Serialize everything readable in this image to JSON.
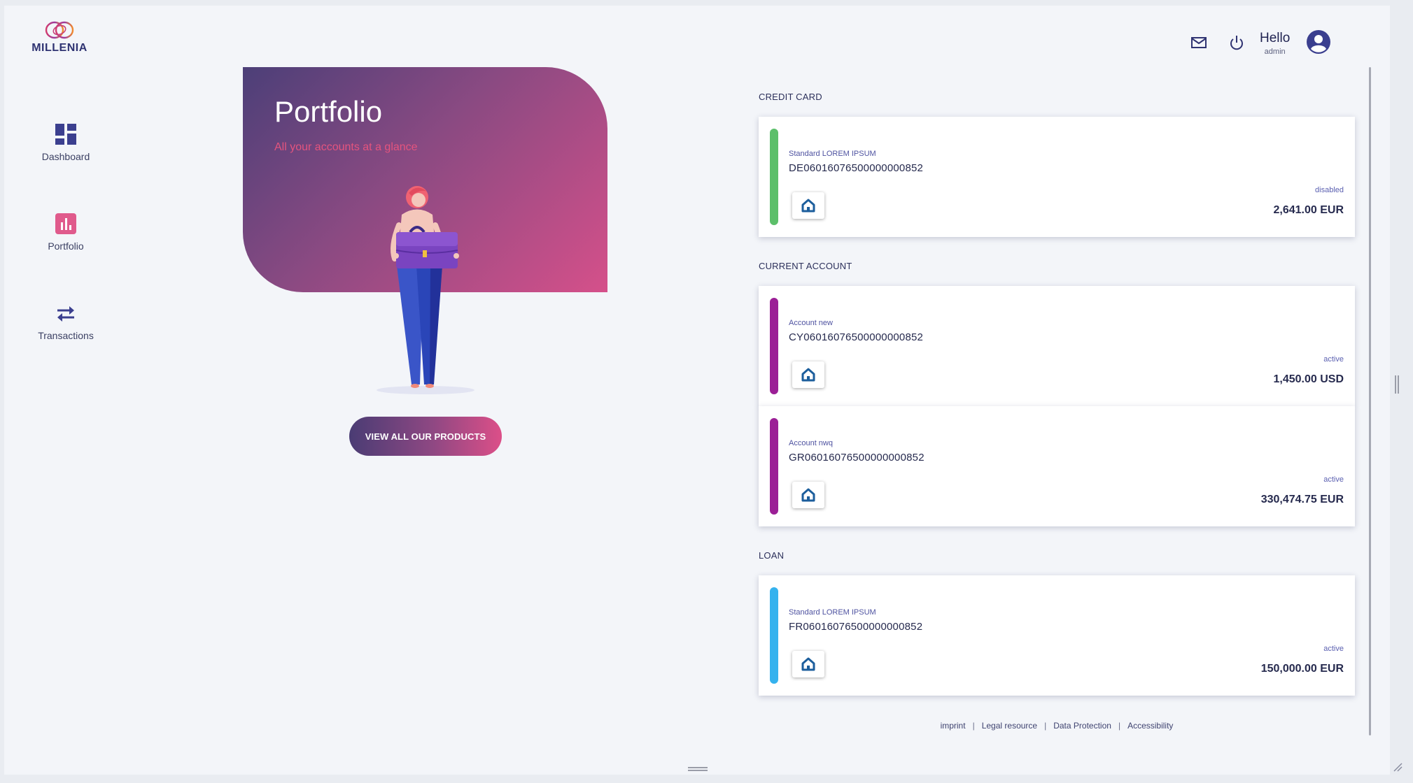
{
  "app": {
    "logo_text": "MILLENIA"
  },
  "sidebar": {
    "items": [
      {
        "label": "Dashboard",
        "icon": "dashboard-icon"
      },
      {
        "label": "Portfolio",
        "icon": "bar-chart-icon"
      },
      {
        "label": "Transactions",
        "icon": "swap-arrows-icon"
      }
    ]
  },
  "header": {
    "greeting": "Hello",
    "username": "admin",
    "icons": [
      "mail-icon",
      "power-icon",
      "account-circle-icon"
    ]
  },
  "hero": {
    "title": "Portfolio",
    "subtitle": "All your accounts at a glance",
    "cta_label": "VIEW ALL OUR PRODUCTS"
  },
  "sections": [
    {
      "title": "CREDIT CARD",
      "accounts": [
        {
          "name": "Standard LOREM IPSUM",
          "iban": "DE06016076500000000852",
          "status": "disabled",
          "amount": "2,641.00 EUR",
          "color": "#5cbf6a"
        }
      ]
    },
    {
      "title": "CURRENT ACCOUNT",
      "accounts": [
        {
          "name": "Account new",
          "iban": "CY06016076500000000852",
          "status": "active",
          "amount": "1,450.00 USD",
          "color": "#9b1f96"
        },
        {
          "name": "Account nwq",
          "iban": "GR06016076500000000852",
          "status": "active",
          "amount": "330,474.75 EUR",
          "color": "#9b1f96"
        }
      ]
    },
    {
      "title": "LOAN",
      "accounts": [
        {
          "name": "Standard LOREM IPSUM",
          "iban": "FR06016076500000000852",
          "status": "active",
          "amount": "150,000.00 EUR",
          "color": "#35b2ee"
        }
      ]
    }
  ],
  "footer": {
    "links": [
      "imprint",
      "Legal resource",
      "Data Protection",
      "Accessibility"
    ]
  },
  "colors": {
    "primary": "#3b3f8f",
    "accent_pink": "#e05a8c",
    "hero_start": "#4c3f78",
    "hero_end": "#d5508a"
  }
}
